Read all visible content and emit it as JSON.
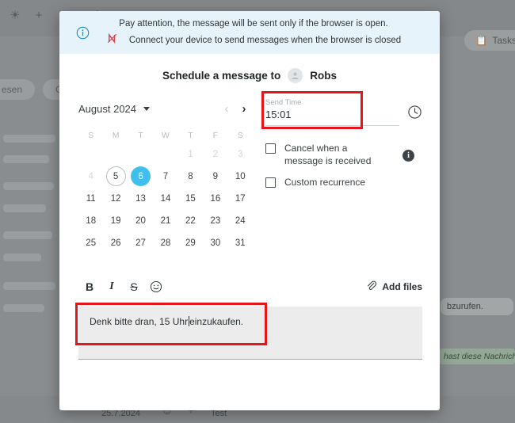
{
  "background": {
    "toolbar_icons": [
      {
        "name": "mute-icon",
        "glyph": "✉"
      },
      {
        "name": "add-person-icon",
        "glyph": "+"
      },
      {
        "name": "device-disconnected-icon",
        "glyph": "N"
      },
      {
        "name": "settings-gear-icon",
        "glyph": "⚙"
      }
    ],
    "filter_pills": [
      "esen",
      "Gruppe"
    ],
    "tasks_button": "Tasks",
    "chat_bubble": "bzurufen.",
    "system_banner": "hast diese Nachricht",
    "bottom_date": "25.7.2024",
    "bottom_input_text": "Test",
    "bottom_icons": [
      {
        "name": "emoji-icon",
        "glyph": "☺"
      },
      {
        "name": "attach-plus-icon",
        "glyph": "+"
      }
    ]
  },
  "notice": {
    "icon": "info-circle-icon",
    "line1": "Pay attention, the message will be sent only if the browser is open.",
    "line2": "Connect your device to send messages when the browser is closed",
    "line2_icon": "device-disconnected-icon",
    "bg_color": "#e7f3fa"
  },
  "dialog": {
    "title": "Schedule a message to",
    "recipient": "Robs",
    "recipient_avatar": "person-avatar-icon"
  },
  "calendar": {
    "month_label": "August 2024",
    "dropdown_icon": "chevron-down-icon",
    "prev_icon": "chevron-left-icon",
    "next_icon": "chevron-right-icon",
    "weekdays": [
      "S",
      "M",
      "T",
      "W",
      "T",
      "F",
      "S"
    ],
    "weeks": [
      [
        {
          "d": "",
          "state": "empty"
        },
        {
          "d": "",
          "state": "empty"
        },
        {
          "d": "",
          "state": "empty"
        },
        {
          "d": "",
          "state": "empty"
        },
        {
          "d": "1",
          "state": "muted"
        },
        {
          "d": "2",
          "state": "muted"
        },
        {
          "d": "3",
          "state": "muted"
        }
      ],
      [
        {
          "d": "4",
          "state": "muted"
        },
        {
          "d": "5",
          "state": "today"
        },
        {
          "d": "6",
          "state": "selected"
        },
        {
          "d": "7",
          "state": "normal"
        },
        {
          "d": "8",
          "state": "normal"
        },
        {
          "d": "9",
          "state": "normal"
        },
        {
          "d": "10",
          "state": "normal"
        }
      ],
      [
        {
          "d": "11",
          "state": "normal"
        },
        {
          "d": "12",
          "state": "normal"
        },
        {
          "d": "13",
          "state": "normal"
        },
        {
          "d": "14",
          "state": "normal"
        },
        {
          "d": "15",
          "state": "normal"
        },
        {
          "d": "16",
          "state": "normal"
        },
        {
          "d": "17",
          "state": "normal"
        }
      ],
      [
        {
          "d": "18",
          "state": "normal"
        },
        {
          "d": "19",
          "state": "normal"
        },
        {
          "d": "20",
          "state": "normal"
        },
        {
          "d": "21",
          "state": "normal"
        },
        {
          "d": "22",
          "state": "normal"
        },
        {
          "d": "23",
          "state": "normal"
        },
        {
          "d": "24",
          "state": "normal"
        }
      ],
      [
        {
          "d": "25",
          "state": "normal"
        },
        {
          "d": "26",
          "state": "normal"
        },
        {
          "d": "27",
          "state": "normal"
        },
        {
          "d": "28",
          "state": "normal"
        },
        {
          "d": "29",
          "state": "normal"
        },
        {
          "d": "30",
          "state": "normal"
        },
        {
          "d": "31",
          "state": "normal"
        }
      ]
    ],
    "selected_color": "#41bfec"
  },
  "send_time": {
    "label": "Send Time",
    "value": "15:01",
    "clock_icon": "clock-icon",
    "highlight_color": "#e8141c"
  },
  "options": {
    "cancel_on_reply": {
      "label": "Cancel when a message is received",
      "checked": false
    },
    "custom_recurrence": {
      "label": "Custom recurrence",
      "checked": false
    },
    "info_icon": "info-filled-icon"
  },
  "editor": {
    "bold": "B",
    "italic": "I",
    "strikethrough": "S",
    "emoji_icon": "emoji-smiley-icon",
    "attach_icon": "paperclip-icon",
    "add_files_label": "Add files",
    "message_before_caret": "Denk bitte dran, 15 Uhr",
    "message_after_caret": "einzukaufen.",
    "underline_color": "#69b6e8",
    "highlight_color": "#e8141c"
  }
}
